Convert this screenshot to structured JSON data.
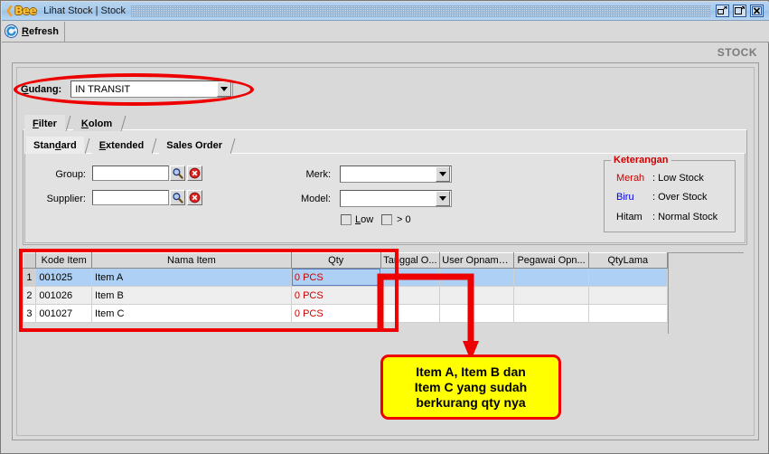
{
  "window": {
    "logo_arrow": "❮",
    "logo_text": "Bee",
    "title": "Lihat Stock | Stock",
    "controls": {
      "restore": "restore-window-button",
      "maximize": "maximize-window-button",
      "close": "close-window-button"
    }
  },
  "toolbar": {
    "refresh_label": "Refresh",
    "refresh_accel": "R"
  },
  "header": {
    "section_title": "STOCK"
  },
  "gudang": {
    "label": "Gudang:",
    "label_accel": "G",
    "value": "IN TRANSIT"
  },
  "tabs": [
    {
      "label": "Filter",
      "accel": "F",
      "active": true
    },
    {
      "label": "Kolom",
      "accel": "K",
      "active": false
    }
  ],
  "subtabs": [
    {
      "label": "Standard",
      "accel": "d",
      "active": true
    },
    {
      "label": "Extended",
      "accel": "E",
      "active": false
    },
    {
      "label": "Sales Order",
      "accel": "",
      "active": false
    }
  ],
  "filter": {
    "group_label": "Group:",
    "group_value": "",
    "supplier_label": "Supplier:",
    "supplier_value": "",
    "merk_label": "Merk:",
    "merk_value": "",
    "model_label": "Model:",
    "model_value": "",
    "low_label": "Low",
    "low_checked": false,
    "gtzero_label": "> 0",
    "gtzero_checked": false,
    "search_icon": "magnifier-icon",
    "clear_icon": "clear-icon"
  },
  "keterangan": {
    "title": "Keterangan",
    "rows": [
      {
        "key": "Merah",
        "sep": ": Low Stock",
        "color": "#cc0000"
      },
      {
        "key": "Biru",
        "sep": ": Over Stock",
        "color": "#0000ee"
      },
      {
        "key": "Hitam",
        "sep": ": Normal Stock",
        "color": "#000000"
      }
    ]
  },
  "table": {
    "columns": [
      "Kode Item",
      "Nama Item",
      "Qty",
      "Tanggal O...",
      "User Opname ...",
      "Pegawai Opn...",
      "QtyLama"
    ],
    "rows": [
      {
        "num": "1",
        "kode": "001025",
        "nama": "Item A",
        "qty": "0 PCS",
        "tanggal": "",
        "user": "",
        "pegawai": "",
        "qtylama": "",
        "selected": true
      },
      {
        "num": "2",
        "kode": "001026",
        "nama": "Item B",
        "qty": "0 PCS",
        "tanggal": "",
        "user": "",
        "pegawai": "",
        "qtylama": "",
        "selected": false
      },
      {
        "num": "3",
        "kode": "001027",
        "nama": "Item C",
        "qty": "0 PCS",
        "tanggal": "",
        "user": "",
        "pegawai": "",
        "qtylama": "",
        "selected": false
      }
    ]
  },
  "annotations": {
    "accent_color": "#ee0000",
    "callout_bg": "#ffff00",
    "callout_lines": [
      "Item A, Item B dan",
      "Item C yang sudah",
      "berkurang qty nya"
    ]
  }
}
